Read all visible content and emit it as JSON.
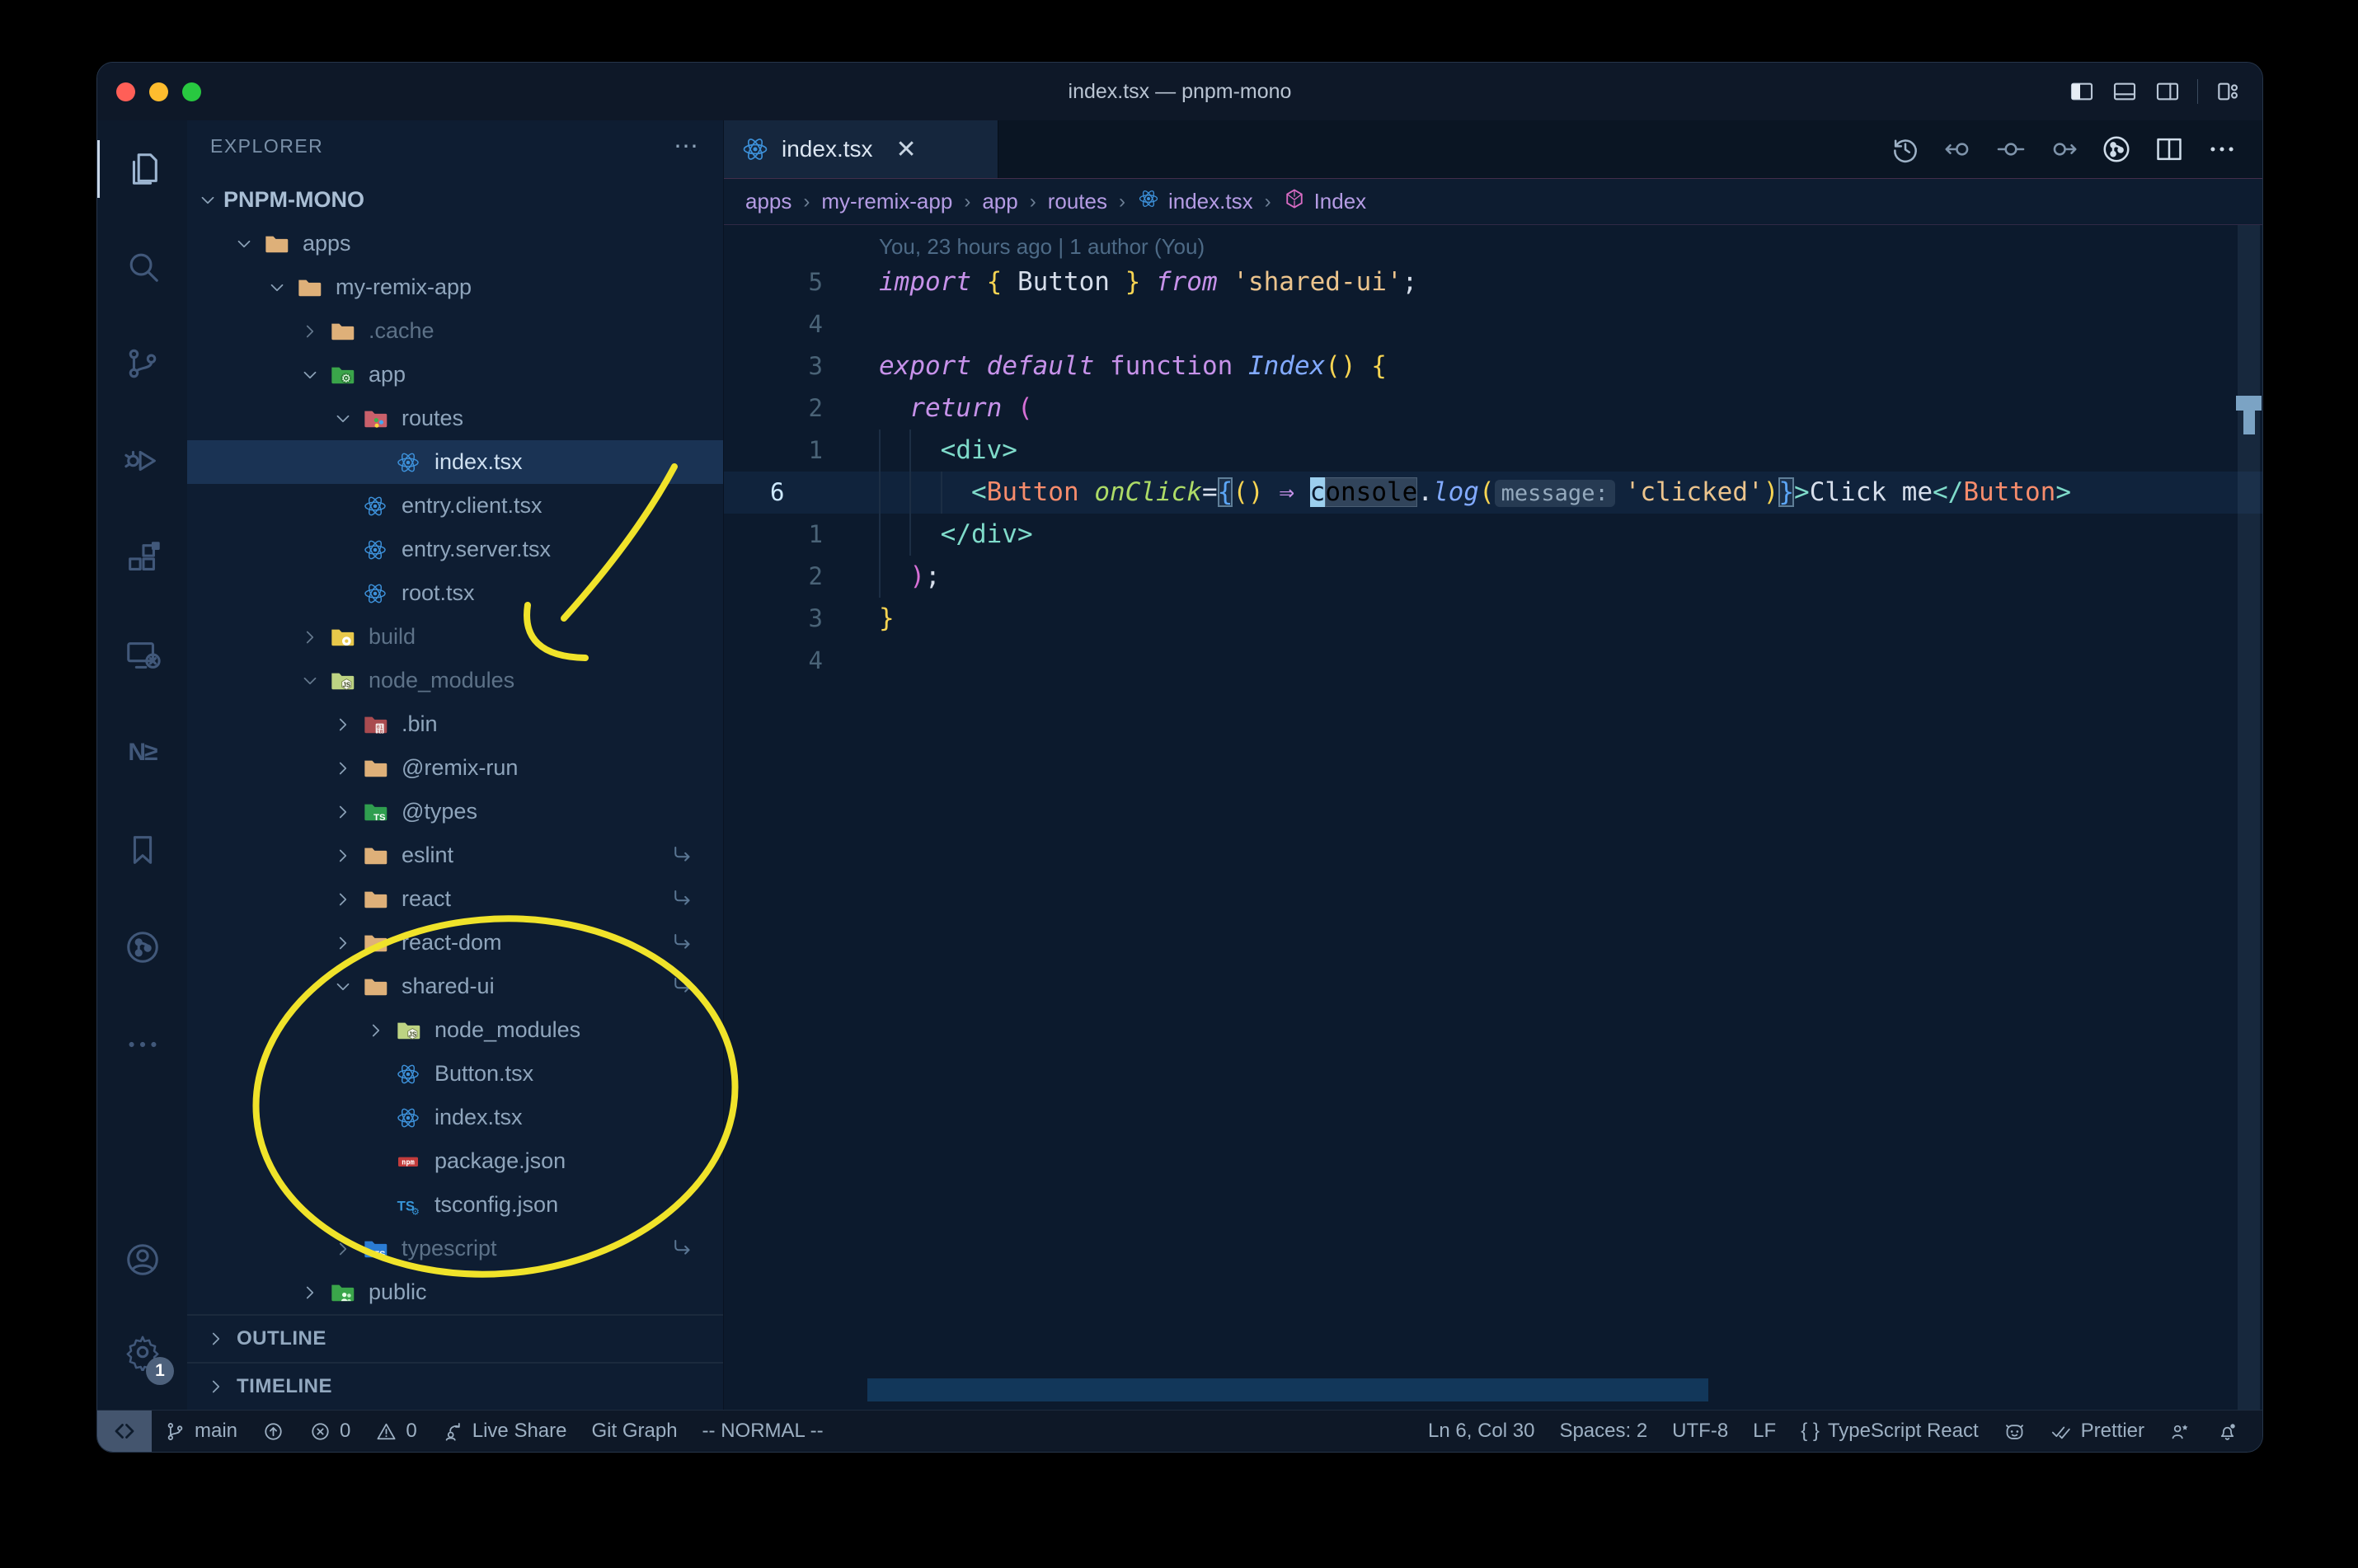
{
  "window": {
    "title": "index.tsx — pnpm-mono"
  },
  "title_bar": {
    "traffic_lights": [
      "close",
      "minimize",
      "zoom"
    ],
    "layout_icons": [
      "layout-sidebar-left",
      "layout-panel",
      "layout-sidebar-right",
      "layout-customize"
    ]
  },
  "activity_bar": {
    "items": [
      {
        "name": "explorer",
        "active": true
      },
      {
        "name": "search"
      },
      {
        "name": "source-control"
      },
      {
        "name": "run-debug"
      },
      {
        "name": "extensions"
      },
      {
        "name": "remote-explorer"
      },
      {
        "name": "nx-console",
        "glyph": "N≥"
      },
      {
        "name": "bookmarks"
      },
      {
        "name": "git-graph"
      },
      {
        "name": "more-views"
      }
    ],
    "bottom": [
      {
        "name": "account"
      },
      {
        "name": "settings",
        "badge": "1"
      }
    ]
  },
  "sidebar": {
    "header": "EXPLORER",
    "header_more": "⋯",
    "root": "PNPM-MONO",
    "tree": [
      {
        "label": "apps",
        "level": 1,
        "chevron": "open",
        "icon": "folder-tan"
      },
      {
        "label": "my-remix-app",
        "level": 2,
        "chevron": "open",
        "icon": "folder-tan"
      },
      {
        "label": ".cache",
        "level": 3,
        "chevron": "closed",
        "icon": "folder-tan",
        "dim": true
      },
      {
        "label": "app",
        "level": 3,
        "chevron": "open",
        "icon": "folder-app"
      },
      {
        "label": "routes",
        "level": 4,
        "chevron": "open",
        "icon": "folder-routes"
      },
      {
        "label": "index.tsx",
        "level": 5,
        "chevron": "none",
        "icon": "react",
        "selected": true
      },
      {
        "label": "entry.client.tsx",
        "level": 4,
        "chevron": "none",
        "icon": "react"
      },
      {
        "label": "entry.server.tsx",
        "level": 4,
        "chevron": "none",
        "icon": "react"
      },
      {
        "label": "root.tsx",
        "level": 4,
        "chevron": "none",
        "icon": "react"
      },
      {
        "label": "build",
        "level": 3,
        "chevron": "closed",
        "icon": "folder-build",
        "dim": true
      },
      {
        "label": "node_modules",
        "level": 3,
        "chevron": "open",
        "icon": "folder-nm",
        "dim": true
      },
      {
        "label": ".bin",
        "level": 4,
        "chevron": "closed",
        "icon": "folder-bin"
      },
      {
        "label": "@remix-run",
        "level": 4,
        "chevron": "closed",
        "icon": "folder-tan"
      },
      {
        "label": "@types",
        "level": 4,
        "chevron": "closed",
        "icon": "folder-types"
      },
      {
        "label": "eslint",
        "level": 4,
        "chevron": "closed",
        "icon": "folder-tan",
        "symlink": true
      },
      {
        "label": "react",
        "level": 4,
        "chevron": "closed",
        "icon": "folder-tan",
        "symlink": true
      },
      {
        "label": "react-dom",
        "level": 4,
        "chevron": "closed",
        "icon": "folder-tan",
        "symlink": true
      },
      {
        "label": "shared-ui",
        "level": 4,
        "chevron": "open",
        "icon": "folder-tan",
        "symlink": true
      },
      {
        "label": "node_modules",
        "level": 5,
        "chevron": "closed",
        "icon": "folder-nm"
      },
      {
        "label": "Button.tsx",
        "level": 5,
        "chevron": "none",
        "icon": "react"
      },
      {
        "label": "index.tsx",
        "level": 5,
        "chevron": "none",
        "icon": "react"
      },
      {
        "label": "package.json",
        "level": 5,
        "chevron": "none",
        "icon": "npm"
      },
      {
        "label": "tsconfig.json",
        "level": 5,
        "chevron": "none",
        "icon": "tsconfig"
      },
      {
        "label": "typescript",
        "level": 4,
        "chevron": "closed",
        "icon": "folder-ts",
        "dim": true,
        "symlink": true
      },
      {
        "label": "public",
        "level": 3,
        "chevron": "closed",
        "icon": "folder-public"
      }
    ],
    "sections": [
      "OUTLINE",
      "TIMELINE"
    ]
  },
  "editor": {
    "tab": {
      "label": "index.tsx",
      "icon": "react",
      "close": "✕"
    },
    "toolbar": [
      "timeline-history",
      "prev-commit",
      "current-commit",
      "next-commit",
      "git-graph",
      "split-editor",
      "more-actions"
    ],
    "breadcrumbs": [
      {
        "label": "apps"
      },
      {
        "label": "my-remix-app"
      },
      {
        "label": "app"
      },
      {
        "label": "routes"
      },
      {
        "label": "index.tsx",
        "icon": "react"
      },
      {
        "label": "Index",
        "icon": "symbol-module"
      }
    ],
    "blame": "You, 23 hours ago | 1 author (You)",
    "lines": [
      {
        "gutter": "5",
        "tokens": [
          [
            "kw",
            "import"
          ],
          [
            "pln",
            " "
          ],
          [
            "bY",
            "{"
          ],
          [
            "pln",
            " Button "
          ],
          [
            "bY",
            "}"
          ],
          [
            "pln",
            " "
          ],
          [
            "kw",
            "from"
          ],
          [
            "pln",
            " "
          ],
          [
            "str",
            "'shared-ui'"
          ],
          [
            "pln",
            ";"
          ]
        ]
      },
      {
        "gutter": "4",
        "tokens": []
      },
      {
        "gutter": "3",
        "tokens": [
          [
            "kw",
            "export"
          ],
          [
            "pln",
            " "
          ],
          [
            "kw",
            "default"
          ],
          [
            "pln",
            " "
          ],
          [
            "kwf",
            "function"
          ],
          [
            "pln",
            " "
          ],
          [
            "fn",
            "Index"
          ],
          [
            "bY",
            "()"
          ],
          [
            "pln",
            " "
          ],
          [
            "bY",
            "{"
          ]
        ]
      },
      {
        "gutter": "2",
        "tokens": [
          [
            "pln",
            "  "
          ],
          [
            "kw",
            "return"
          ],
          [
            "pln",
            " "
          ],
          [
            "bP",
            "("
          ]
        ]
      },
      {
        "gutter": "1",
        "tokens": [
          [
            "pln",
            "    "
          ],
          [
            "tag",
            "<div>"
          ]
        ]
      },
      {
        "gutter": "6",
        "current": true,
        "tokens": [
          [
            "pln",
            "      "
          ],
          [
            "tag",
            "<"
          ],
          [
            "cmp",
            "Button"
          ],
          [
            "pln",
            " "
          ],
          [
            "attr",
            "onClick"
          ],
          [
            "pln",
            "="
          ],
          [
            "bBx",
            "{"
          ],
          [
            "bY",
            "()"
          ],
          [
            "pln",
            " "
          ],
          [
            "arrow",
            "⇒"
          ],
          [
            "pln",
            " "
          ],
          [
            "cur",
            "c"
          ],
          [
            "whl",
            "onsole"
          ],
          [
            "pln",
            "."
          ],
          [
            "fn",
            "log"
          ],
          [
            "bY",
            "("
          ],
          [
            "inl",
            "message:"
          ],
          [
            "str",
            "'clicked'"
          ],
          [
            "bY",
            ")"
          ],
          [
            "bBx",
            "}"
          ],
          [
            "tag",
            ">"
          ],
          [
            "pln",
            "Click me"
          ],
          [
            "tag",
            "</"
          ],
          [
            "cmp",
            "Button"
          ],
          [
            "tag",
            ">"
          ]
        ]
      },
      {
        "gutter": "1",
        "tokens": [
          [
            "pln",
            "    "
          ],
          [
            "tag",
            "</div>"
          ]
        ]
      },
      {
        "gutter": "2",
        "tokens": [
          [
            "pln",
            "  "
          ],
          [
            "bP",
            ")"
          ],
          [
            "pln",
            ";"
          ]
        ]
      },
      {
        "gutter": "3",
        "tokens": [
          [
            "bY",
            "}"
          ]
        ]
      },
      {
        "gutter": "4",
        "tokens": []
      }
    ]
  },
  "status_bar": {
    "left": [
      {
        "icon": "branch",
        "label": "main",
        "name": "git-branch"
      },
      {
        "icon": "sync",
        "label": "",
        "name": "sync"
      },
      {
        "icon": "error",
        "label": "0",
        "name": "errors"
      },
      {
        "icon": "warning",
        "label": "0",
        "name": "warnings"
      },
      {
        "icon": "liveshare",
        "label": "Live Share",
        "name": "live-share"
      },
      {
        "label": "Git Graph",
        "name": "git-graph"
      },
      {
        "label": "-- NORMAL --",
        "name": "vim-mode"
      }
    ],
    "right": [
      {
        "label": "Ln 6, Col 30",
        "name": "cursor-position"
      },
      {
        "label": "Spaces: 2",
        "name": "indentation"
      },
      {
        "label": "UTF-8",
        "name": "encoding"
      },
      {
        "label": "LF",
        "name": "eol"
      },
      {
        "icon": "braces",
        "label": "TypeScript React",
        "name": "language-mode"
      },
      {
        "icon": "octoface",
        "label": "",
        "name": "github"
      },
      {
        "icon": "check-double",
        "label": "Prettier",
        "name": "formatter"
      },
      {
        "icon": "feedback",
        "label": "",
        "name": "feedback"
      },
      {
        "icon": "bell-dot",
        "label": "",
        "name": "notifications"
      }
    ]
  },
  "annotations": {
    "color": "#f0e32a"
  }
}
